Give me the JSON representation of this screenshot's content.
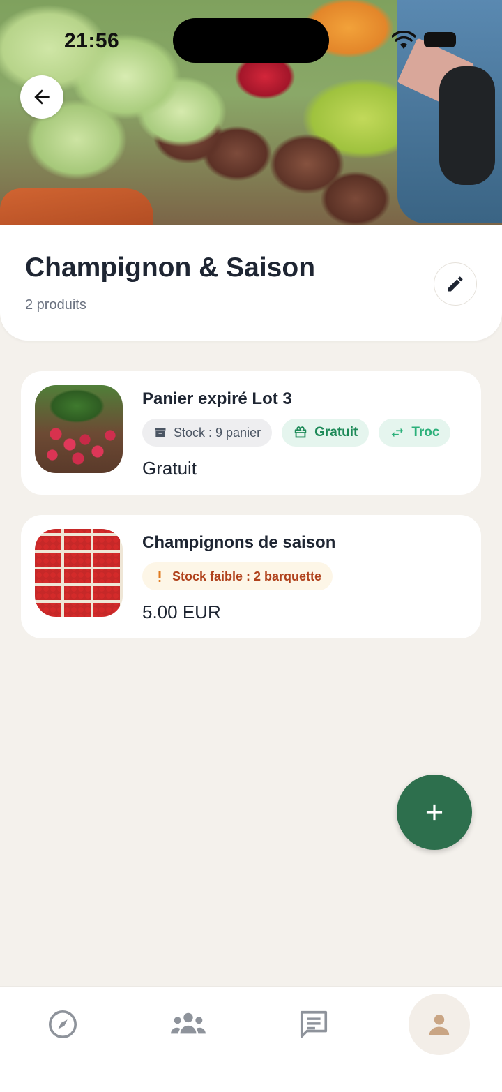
{
  "status_bar": {
    "time": "21:56"
  },
  "header": {
    "title": "Champignon & Saison",
    "subtitle": "2 produits"
  },
  "products": [
    {
      "name": "Panier expiré Lot 3",
      "tags": [
        {
          "label": "Stock : 9 panier",
          "icon": "archive-icon"
        },
        {
          "label": "Gratuit",
          "icon": "gift-icon"
        },
        {
          "label": "Troc",
          "icon": "swap-icon"
        }
      ],
      "price": "Gratuit"
    },
    {
      "name": "Champignons de saison",
      "tags": [
        {
          "label": "Stock faible : 2 barquette",
          "icon": "exclamation-icon"
        }
      ],
      "price": "5.00 EUR"
    }
  ],
  "colors": {
    "primary": "#2d6f4d",
    "background": "#f4f1ec",
    "free_text": "#1d8a58",
    "warn_text": "#b0421c"
  },
  "nav": [
    {
      "icon": "compass-icon",
      "active": false
    },
    {
      "icon": "community-icon",
      "active": false
    },
    {
      "icon": "messages-icon",
      "active": false
    },
    {
      "icon": "profile-icon",
      "active": true
    }
  ]
}
